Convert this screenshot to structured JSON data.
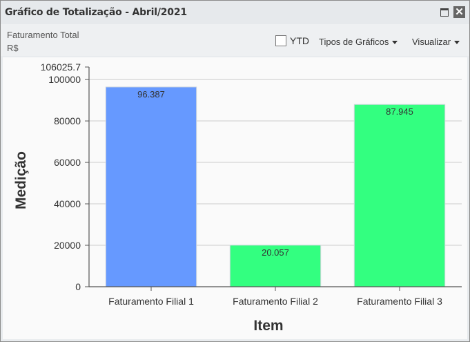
{
  "window": {
    "title": "Gráfico de Totalização - Abril/2021",
    "maximize_icon": "maximize-icon",
    "close_icon": "close-icon",
    "close_glyph": "✕"
  },
  "subheader": {
    "title": "Faturamento Total",
    "unit": "R$",
    "ytd_label": "YTD",
    "ytd_checked": false,
    "chart_types_label": "Tipos de Gráficos",
    "view_label": "Visualizar"
  },
  "chart_data": {
    "type": "bar",
    "categories": [
      "Faturamento Filial 1",
      "Faturamento Filial 2",
      "Faturamento Filial 3"
    ],
    "values": [
      96387,
      20057,
      87945
    ],
    "value_labels": [
      "96.387",
      "20.057",
      "87.945"
    ],
    "bar_colors": [
      "#6699ff",
      "#33ff80",
      "#33ff80"
    ],
    "xlabel": "Item",
    "ylabel": "Medição",
    "ylim": [
      0,
      106025.7
    ],
    "yticks": [
      "0",
      "20000",
      "40000",
      "60000",
      "80000",
      "100000",
      "106025.7"
    ],
    "ytick_values": [
      0,
      20000,
      40000,
      60000,
      80000,
      100000,
      106025.7
    ],
    "grid": true
  }
}
